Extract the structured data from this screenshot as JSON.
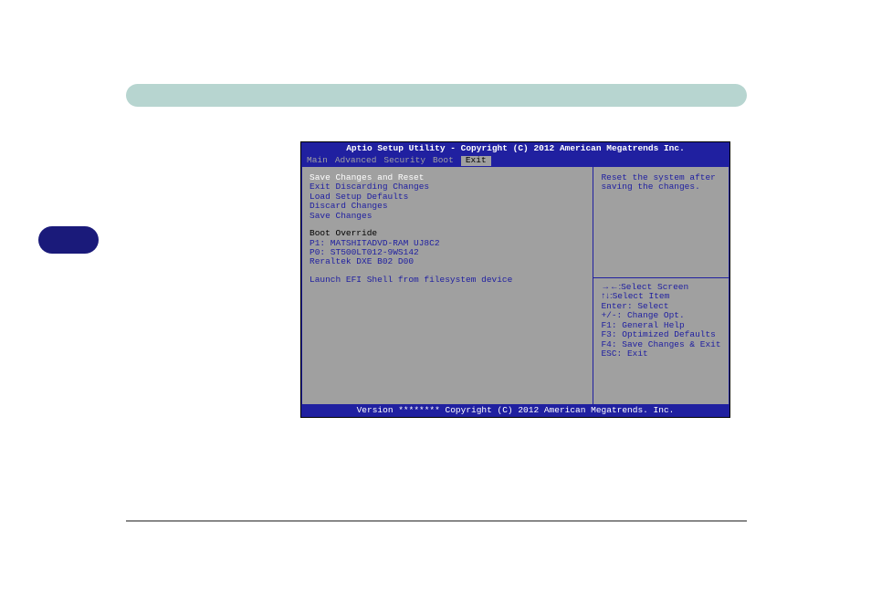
{
  "header_title": "Aptio Setup Utility - Copyright (C) 2012 American Megatrends Inc.",
  "tabs": {
    "main": "Main",
    "advanced": "Advanced",
    "security": "Security",
    "boot": "Boot",
    "exit": "Exit"
  },
  "menu": {
    "save_changes_reset": "Save Changes and Reset",
    "exit_discarding": "Exit Discarding Changes",
    "load_defaults": "Load Setup Defaults",
    "discard_changes": "Discard Changes",
    "save_changes": "Save Changes",
    "boot_override": "Boot Override",
    "device_p1": "P1: MATSHITADVD-RAM UJ8C2",
    "device_p0": "P0: ST500LT012-9WS142",
    "device_realtek": "Reraltek DXE B02 D00",
    "launch_efi": "Launch EFI Shell from filesystem device"
  },
  "help_text": "Reset the system after saving the changes.",
  "nav_help": {
    "select_screen_arrows": "→←:",
    "select_screen": "Select Screen",
    "select_item_arrows": "↑↓:",
    "select_item": "Select Item",
    "enter": "Enter: Select",
    "change": "+/-: Change Opt.",
    "f1": "F1: General Help",
    "f3": "F3: Optimized Defaults",
    "f4": "F4: Save Changes & Exit",
    "esc": "ESC: Exit"
  },
  "footer": "Version ******** Copyright (C) 2012 American Megatrends. Inc."
}
